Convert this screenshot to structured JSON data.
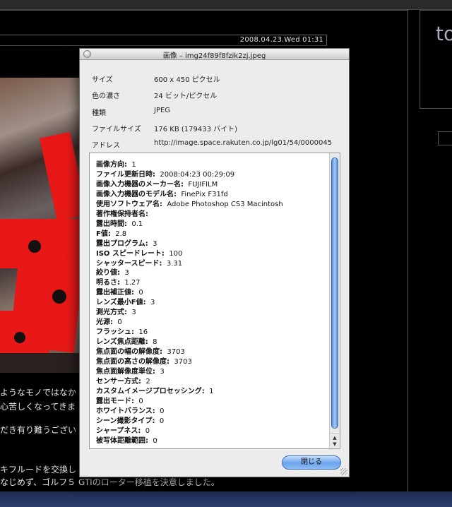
{
  "background": {
    "date": "2008.04.23.Wed 01:31",
    "side_text": "to",
    "blog_lines": [
      "ようなモノではなか",
      "心苦しくなってきま",
      "だき有り難うござい",
      "キフルードを交換し",
      "なじめず、ゴルフ５ GTIのローター移植を決意しました。"
    ]
  },
  "window": {
    "title": "画像 – img24f89f8fzik2zj.jpeg",
    "info": [
      {
        "label": "サイズ",
        "value": "600 x 450 ピクセル"
      },
      {
        "label": "色の濃さ",
        "value": "24 ビット/ピクセル"
      },
      {
        "label": "種類",
        "value": "JPEG"
      },
      {
        "label": "ファイルサイズ",
        "value": "176 KB (179433 バイト)"
      },
      {
        "label": "アドレス",
        "value": "http://image.space.rakuten.co.jp/lg01/54/0000045"
      }
    ],
    "exif": [
      {
        "key": "画像方向:",
        "value": "1"
      },
      {
        "key": "ファイル更新日時:",
        "value": "2008:04:23 00:29:09"
      },
      {
        "key": "画像入力機器のメーカー名:",
        "value": "FUJIFILM"
      },
      {
        "key": "画像入力機器のモデル名:",
        "value": "FinePix F31fd"
      },
      {
        "key": "使用ソフトウェア名:",
        "value": "Adobe Photoshop CS3 Macintosh"
      },
      {
        "key": "著作権保持者名:",
        "value": ""
      },
      {
        "key": "露出時間:",
        "value": "0.1"
      },
      {
        "key": "F値:",
        "value": "2.8"
      },
      {
        "key": "露出プログラム:",
        "value": "3"
      },
      {
        "key": "ISO スピードレート:",
        "value": "100"
      },
      {
        "key": "シャッタースピード:",
        "value": "3.31"
      },
      {
        "key": "絞り値:",
        "value": "3"
      },
      {
        "key": "明るさ:",
        "value": "1.27"
      },
      {
        "key": "露出補正値:",
        "value": "0"
      },
      {
        "key": "レンズ最小F値:",
        "value": "3"
      },
      {
        "key": "測光方式:",
        "value": "3"
      },
      {
        "key": "光源:",
        "value": "0"
      },
      {
        "key": "フラッシュ:",
        "value": "16"
      },
      {
        "key": "レンズ焦点距離:",
        "value": "8"
      },
      {
        "key": "焦点面の幅の解像度:",
        "value": "3703"
      },
      {
        "key": "焦点面の高さの解像度:",
        "value": "3703"
      },
      {
        "key": "焦点面解像度単位:",
        "value": "3"
      },
      {
        "key": "センサー方式:",
        "value": "2"
      },
      {
        "key": "カスタムイメージプロセッシング:",
        "value": "1"
      },
      {
        "key": "露出モード:",
        "value": "0"
      },
      {
        "key": "ホワイトバランス:",
        "value": "0"
      },
      {
        "key": "シーン撮影タイプ:",
        "value": "0"
      },
      {
        "key": "シャープネス:",
        "value": "0"
      },
      {
        "key": "被写体距離範囲:",
        "value": "0"
      }
    ],
    "close_label": "閉じる",
    "scroll_up_icon": "▲",
    "scroll_down_icon": "▼"
  }
}
